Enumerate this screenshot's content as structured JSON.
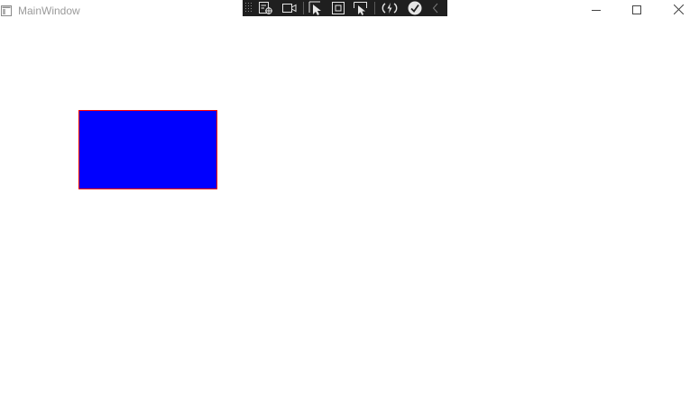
{
  "window": {
    "title": "MainWindow",
    "icon": "app-window-icon"
  },
  "caption_buttons": {
    "minimize_icon": "minimize-icon",
    "maximize_icon": "maximize-icon",
    "close_icon": "close-icon"
  },
  "debug_toolbar": {
    "items": [
      {
        "name": "select-element-icon"
      },
      {
        "name": "track-focus-icon"
      },
      {
        "name": "select-element-in-app-icon"
      },
      {
        "name": "display-layout-adorners-icon"
      },
      {
        "name": "toggle-preview-selection-icon"
      },
      {
        "name": "hot-reload-icon"
      },
      {
        "name": "binding-failures-check-icon"
      },
      {
        "name": "collapse-toolbar-icon"
      }
    ]
  },
  "content": {
    "rectangle": {
      "fill": "#0000ff",
      "stroke": "#ff0000"
    }
  },
  "colors": {
    "toolbar_bg": "#1f1f1f",
    "title_text": "#9a9a9a"
  }
}
